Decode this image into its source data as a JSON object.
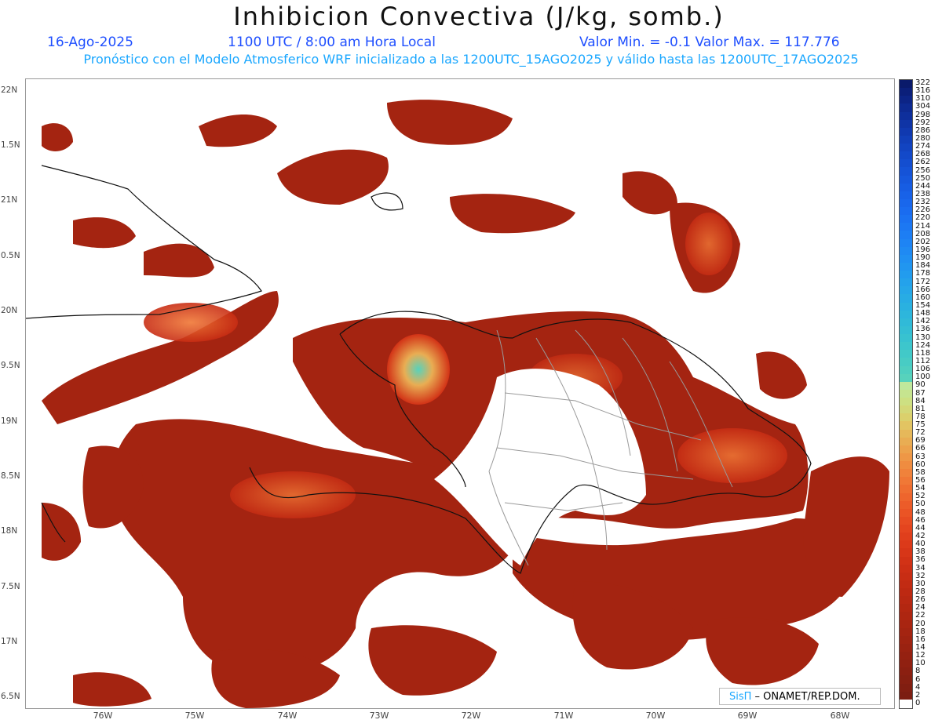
{
  "title": "Inhibicion Convectiva (J/kg, somb.)",
  "date": "16-Ago-2025",
  "time": "1100 UTC / 8:00 am Hora Local",
  "minmax": "Valor Min. = -0.1   Valor Max. = 117.776",
  "forecast": "Pronóstico con el Modelo Atmosferico WRF inicializado a las 1200UTC_15AGO2025 y válido hasta las  1200UTC_17AGO2025",
  "lat_labels": [
    "22N",
    "1.5N",
    "21N",
    "0.5N",
    "20N",
    "9.5N",
    "19N",
    "8.5N",
    "18N",
    "7.5N",
    "17N",
    "6.5N"
  ],
  "lon_labels": [
    "76W",
    "75W",
    "74W",
    "73W",
    "72W",
    "71W",
    "70W",
    "69W",
    "68W"
  ],
  "colorbar": {
    "labels": [
      "322",
      "316",
      "310",
      "304",
      "298",
      "292",
      "286",
      "280",
      "274",
      "268",
      "262",
      "256",
      "250",
      "244",
      "238",
      "232",
      "226",
      "220",
      "214",
      "208",
      "202",
      "196",
      "190",
      "184",
      "178",
      "172",
      "166",
      "160",
      "154",
      "148",
      "142",
      "136",
      "130",
      "124",
      "118",
      "112",
      "106",
      "100",
      "90",
      "87",
      "84",
      "81",
      "78",
      "75",
      "72",
      "69",
      "66",
      "63",
      "60",
      "58",
      "56",
      "54",
      "52",
      "50",
      "48",
      "46",
      "44",
      "42",
      "40",
      "38",
      "36",
      "34",
      "32",
      "30",
      "28",
      "26",
      "24",
      "22",
      "20",
      "18",
      "16",
      "14",
      "12",
      "10",
      "8",
      "6",
      "4",
      "2",
      "0"
    ],
    "colors": [
      "#0a1a6b",
      "#0b1f7a",
      "#0c2486",
      "#0d2a92",
      "#0e2f9c",
      "#0f34a6",
      "#1039b0",
      "#113fb9",
      "#1244c1",
      "#1349c9",
      "#144ed0",
      "#1553d7",
      "#1658dd",
      "#175de3",
      "#1862e8",
      "#1967ec",
      "#1a6cf0",
      "#1b72f2",
      "#1c78f3",
      "#1d7ef4",
      "#1e84f4",
      "#1f8af3",
      "#2090f2",
      "#2196f0",
      "#229cee",
      "#24a2eb",
      "#26a7e8",
      "#28ace4",
      "#2ab1e0",
      "#2db6dc",
      "#30bad8",
      "#34bed4",
      "#38c2d0",
      "#3dc6cc",
      "#42c9c8",
      "#48ccc4",
      "#4fcfc0",
      "#57d2bc",
      "#bfe89c",
      "#c6e48f",
      "#cde082",
      "#d4d877",
      "#dbd06c",
      "#e2c462",
      "#e6b85a",
      "#e9ad53",
      "#eca24c",
      "#ee9746",
      "#ef8c40",
      "#f0823b",
      "#f07836",
      "#ef6e31",
      "#ee652d",
      "#ec5c29",
      "#ea5425",
      "#e74c22",
      "#e4451f",
      "#e03f1c",
      "#dc3a1a",
      "#d73618",
      "#d23216",
      "#cd2f15",
      "#c82d14",
      "#c22b13",
      "#bd2912",
      "#b82812",
      "#b32711",
      "#ae2611",
      "#a92511",
      "#a42411",
      "#9f2311",
      "#9a2211",
      "#952111",
      "#902011",
      "#8b1f11",
      "#861f11",
      "#811e11",
      "#7c1d11",
      "#ffffff"
    ]
  },
  "credit": {
    "logo": "SisΠ",
    "text": " – ONAMET/REP.DOM."
  }
}
